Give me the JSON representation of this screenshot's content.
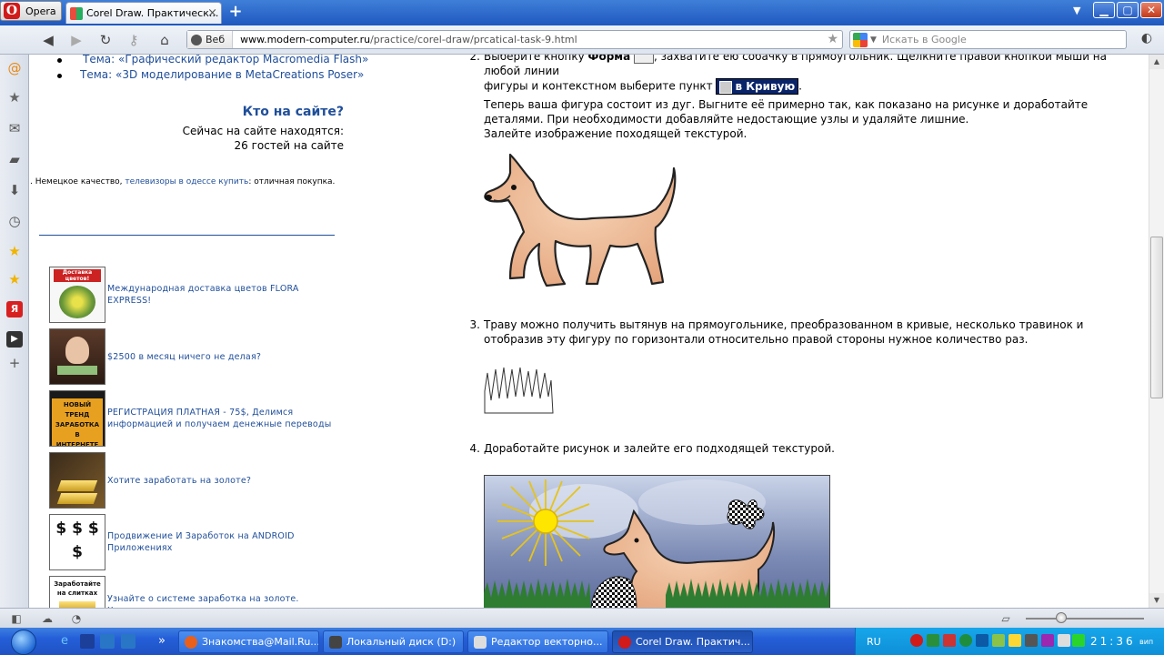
{
  "browser": {
    "menu_label": "Opera",
    "tabs": [
      {
        "title": "Corel Draw. Практическ...",
        "close": "×"
      }
    ],
    "new_tab": "+",
    "address_badge": "Веб",
    "url_host": "www.modern-computer.ru",
    "url_path": "/practice/corel-draw/prcatical-task-9.html",
    "search_placeholder": "Искать в Google"
  },
  "sidebar_left": {
    "topics": [
      "Тема: «Графический редактор Macromedia Flash»",
      "Тема: «3D моделирование в MetaCreations Poser»"
    ],
    "who_heading": "Кто на сайте?",
    "who_line1": "Сейчас на сайте находятся:",
    "who_line2": "26 гостей на сайте",
    "promo_before": ". Немецкое качество, ",
    "promo_link": "телевизоры в одессе купить",
    "promo_after": ": отличная покупка.",
    "ads": [
      {
        "img_label": "Доставка цветов!",
        "text": "Международная доставка цветов FLORA EXPRESS!"
      },
      {
        "img_label": "",
        "text": "$2500 в месяц ничего не делая?"
      },
      {
        "img_label": "НОВЫЙ ТРЕНД ЗАРАБОТКА В ИНТЕРНЕТЕ",
        "text": "РЕГИСТРАЦИЯ ПЛАТНАЯ - 75$, Делимся информацией и получаем денежные переводы"
      },
      {
        "img_label": "",
        "text": "Хотите заработать на золоте?"
      },
      {
        "img_label": "$ $ $ $",
        "text": "Продвижение И Заработок на ANDROID Приложениях"
      },
      {
        "img_label": "Заработайте на слитках",
        "text": "Узнайте о системе заработка на золоте. Хватит"
      }
    ]
  },
  "article": {
    "step2_num": "2.",
    "step2_a": "Выберите кнопку ",
    "step2_bold": "Форма",
    "step2_b": ", захватите ею собачку в прямоугольник. Щелкните правой кнопкой мыши на любой линии",
    "step2_c": "фигуры и контекстном выберите пункт ",
    "step2_btn": "в Кривую",
    "step2_d": "Теперь ваша фигура состоит из дуг. Выгните её примерно так, как показано на рисунке и доработайте деталями. При необходимости добавляйте недостающие узлы и удаляйте лишние.",
    "step2_e": "Залейте изображение походящей текстурой.",
    "step3_num": "3.",
    "step3_text": "Траву можно получить вытянув на прямоугольнике, преобразованном в кривые, несколько травинок и отобразив эту фигуру по горизонтали относительно правой стороны нужное количество раз.",
    "step4_num": "4.",
    "step4_text": "Доработайте рисунок и залейте его подходящей текстурой."
  },
  "taskbar": {
    "tasks": [
      {
        "label": "Знакомства@Mail.Ru...",
        "color": "#e8601c"
      },
      {
        "label": "Локальный диск (D:)",
        "color": "#444444"
      },
      {
        "label": "Редактор векторно...",
        "color": "#dddddd"
      },
      {
        "label": "Corel Draw. Практич...",
        "color": "#d11a1a"
      }
    ],
    "lang": "RU",
    "clock": "21:36",
    "ampm": "вип"
  }
}
